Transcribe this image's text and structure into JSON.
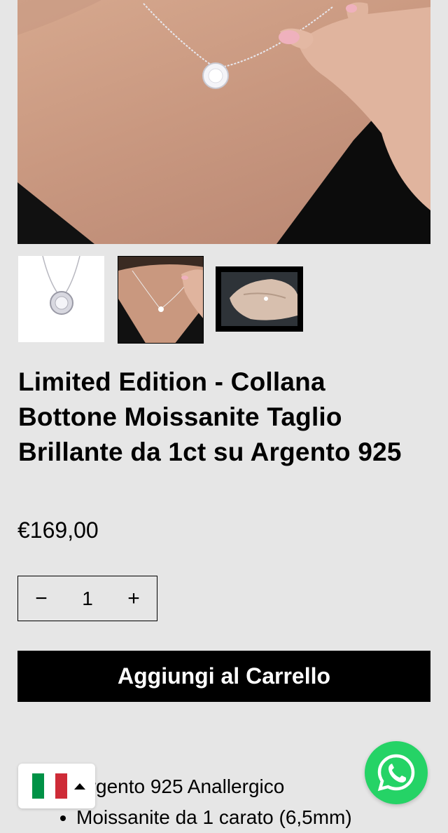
{
  "product": {
    "title": "Limited Edition - Collana Bottone Moissanite Taglio Brillante da 1ct su Argento 925",
    "price": "€169,00",
    "quantity": "1",
    "add_to_cart_label": "Aggiungi al Carrello",
    "features": [
      "Argento 925 Anallergico",
      "Moissanite da 1 carato (6,5mm)"
    ]
  },
  "gallery": {
    "main_image": "necklace-on-model-closeup",
    "thumbnails": [
      "necklace-product-white",
      "necklace-on-model",
      "necklace-in-hand-video"
    ]
  },
  "quantity_selector": {
    "decrease_symbol": "−",
    "increase_symbol": "+"
  },
  "language_switcher": {
    "flag": "italy-flag",
    "flag_colors": [
      "#009246",
      "#ffffff",
      "#ce2b37"
    ]
  },
  "colors": {
    "background": "#e6e6e6",
    "button_bg": "#000000",
    "button_text": "#ffffff",
    "whatsapp": "#25d366"
  },
  "icons": {
    "whatsapp": "whatsapp-icon",
    "caret": "caret-up-icon"
  }
}
